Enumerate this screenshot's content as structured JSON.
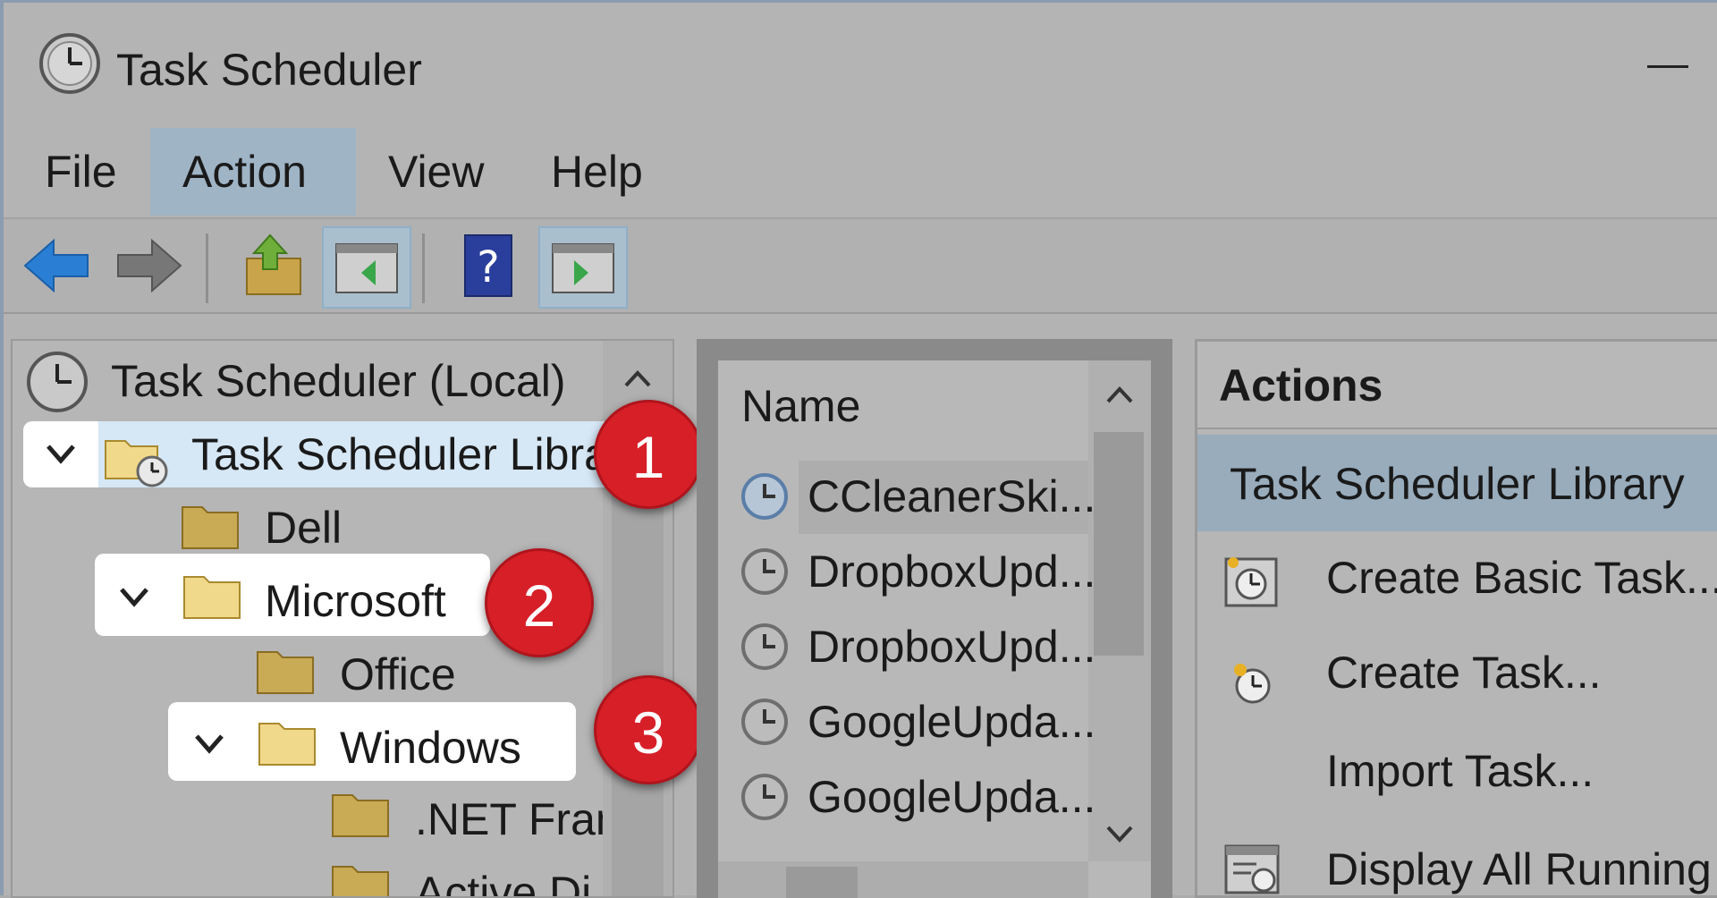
{
  "window": {
    "title": "Task Scheduler"
  },
  "menu": {
    "file": "File",
    "action": "Action",
    "view": "View",
    "help": "Help"
  },
  "toolbar": {
    "icons": [
      "back-arrow-icon",
      "forward-arrow-icon",
      "up-folder-icon",
      "show-hide-console-tree-icon",
      "help-icon",
      "show-hide-action-pane-icon"
    ]
  },
  "tree": {
    "root": "Task Scheduler (Local)",
    "library": "Task Scheduler Libra",
    "dell": "Dell",
    "microsoft": "Microsoft",
    "office": "Office",
    "windows": "Windows",
    "netfr": ".NET Fran",
    "activedi": "Active Di"
  },
  "badges": [
    "1",
    "2",
    "3"
  ],
  "tasks": {
    "column_name": "Name",
    "rows": [
      "CCleanerSki...",
      "DropboxUpd...",
      "DropboxUpd...",
      "GoogleUpda...",
      "GoogleUpda..."
    ]
  },
  "actions": {
    "header": "Actions",
    "section": "Task Scheduler Library",
    "items": [
      "Create Basic Task...",
      "Create Task...",
      "Import Task...",
      "Display All Running"
    ]
  },
  "colors": {
    "badge": "#d71f28",
    "selection": "#9fb4c5",
    "highlight": "#ffffff"
  }
}
